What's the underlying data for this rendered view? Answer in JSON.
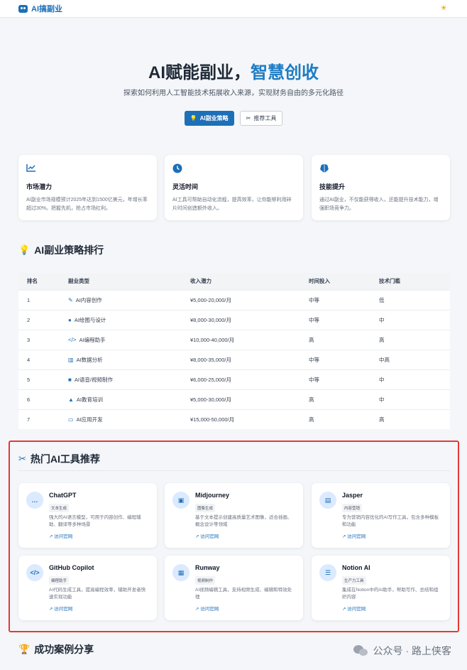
{
  "nav": {
    "brand": "AI搞副业",
    "theme_icon": "sun-icon"
  },
  "hero": {
    "title_main": "AI赋能副业，",
    "title_highlight": "智慧创收",
    "subtitle": "探索如何利用人工智能技术拓展收入来源，实现财务自由的多元化路径",
    "btn_primary": "AI副业策略",
    "btn_secondary": "推荐工具"
  },
  "stats": [
    {
      "icon": "chart-line-icon",
      "title": "市场潜力",
      "desc": "AI副业市场规模预计2025年达到1500亿美元，年增长率超过30%。把握先机，抢占市场红利。"
    },
    {
      "icon": "clock-icon",
      "title": "灵活时间",
      "desc": "AI工具可帮助自动化流程，提高效率，让你能够利用碎片时间创造额外收入。"
    },
    {
      "icon": "brain-icon",
      "title": "技能提升",
      "desc": "通过AI副业，不仅能获得收入，还能提升技术能力，增强职场竞争力。"
    }
  ],
  "ranking": {
    "title": "AI副业策略排行",
    "headers": [
      "排名",
      "副业类型",
      "收入潜力",
      "时间投入",
      "技术门槛"
    ],
    "rows": [
      {
        "rank": "1",
        "icon": "pen-icon",
        "type": "AI内容创作",
        "income": "¥5,000-20,000/月",
        "time": "中等",
        "tech": "低"
      },
      {
        "rank": "2",
        "icon": "palette-icon",
        "type": "AI绘图与设计",
        "income": "¥8,000-30,000/月",
        "time": "中等",
        "tech": "中"
      },
      {
        "rank": "3",
        "icon": "code-icon",
        "type": "AI编程助手",
        "income": "¥10,000-40,000/月",
        "time": "高",
        "tech": "高"
      },
      {
        "rank": "4",
        "icon": "bar-chart-icon",
        "type": "AI数据分析",
        "income": "¥8,000-35,000/月",
        "time": "中等",
        "tech": "中高"
      },
      {
        "rank": "5",
        "icon": "video-icon",
        "type": "AI语音/视频制作",
        "income": "¥6,000-25,000/月",
        "time": "中等",
        "tech": "中"
      },
      {
        "rank": "6",
        "icon": "graduation-cap-icon",
        "type": "AI教育培训",
        "income": "¥5,000-30,000/月",
        "time": "高",
        "tech": "中"
      },
      {
        "rank": "7",
        "icon": "laptop-icon",
        "type": "AI应用开发",
        "income": "¥15,000-50,000/月",
        "time": "高",
        "tech": "高"
      }
    ]
  },
  "tools": {
    "title": "热门AI工具推荐",
    "items": [
      {
        "icon": "chat-icon",
        "name": "ChatGPT",
        "badge": "文本生成",
        "desc": "强大的AI语言模型，可用于内容创作、编程辅助、翻译等多种场景",
        "link": "访问官网"
      },
      {
        "icon": "image-icon",
        "name": "Midjourney",
        "badge": "图像生成",
        "desc": "基于文本提示创建高质量艺术图像，适合插画、概念设计等领域",
        "link": "访问官网"
      },
      {
        "icon": "file-icon",
        "name": "Jasper",
        "badge": "内容营销",
        "desc": "专为营销内容优化的AI写作工具，包含多种模板和功能",
        "link": "访问官网"
      },
      {
        "icon": "code-icon",
        "name": "GitHub Copilot",
        "badge": "编程助手",
        "desc": "AI代码生成工具，提高编程效率，辅助开发者快速实现功能",
        "link": "访问官网"
      },
      {
        "icon": "film-icon",
        "name": "Runway",
        "badge": "视频制作",
        "desc": "AI视频编辑工具，支持视频生成、编辑和特效处理",
        "link": "访问官网"
      },
      {
        "icon": "list-icon",
        "name": "Notion AI",
        "badge": "生产力工具",
        "desc": "集成在Notion中的AI助手，帮助写作、总结和组织内容",
        "link": "访问官网"
      }
    ]
  },
  "cases": {
    "title": "成功案例分享"
  },
  "watermark": {
    "text": "公众号 · 路上侠客"
  }
}
